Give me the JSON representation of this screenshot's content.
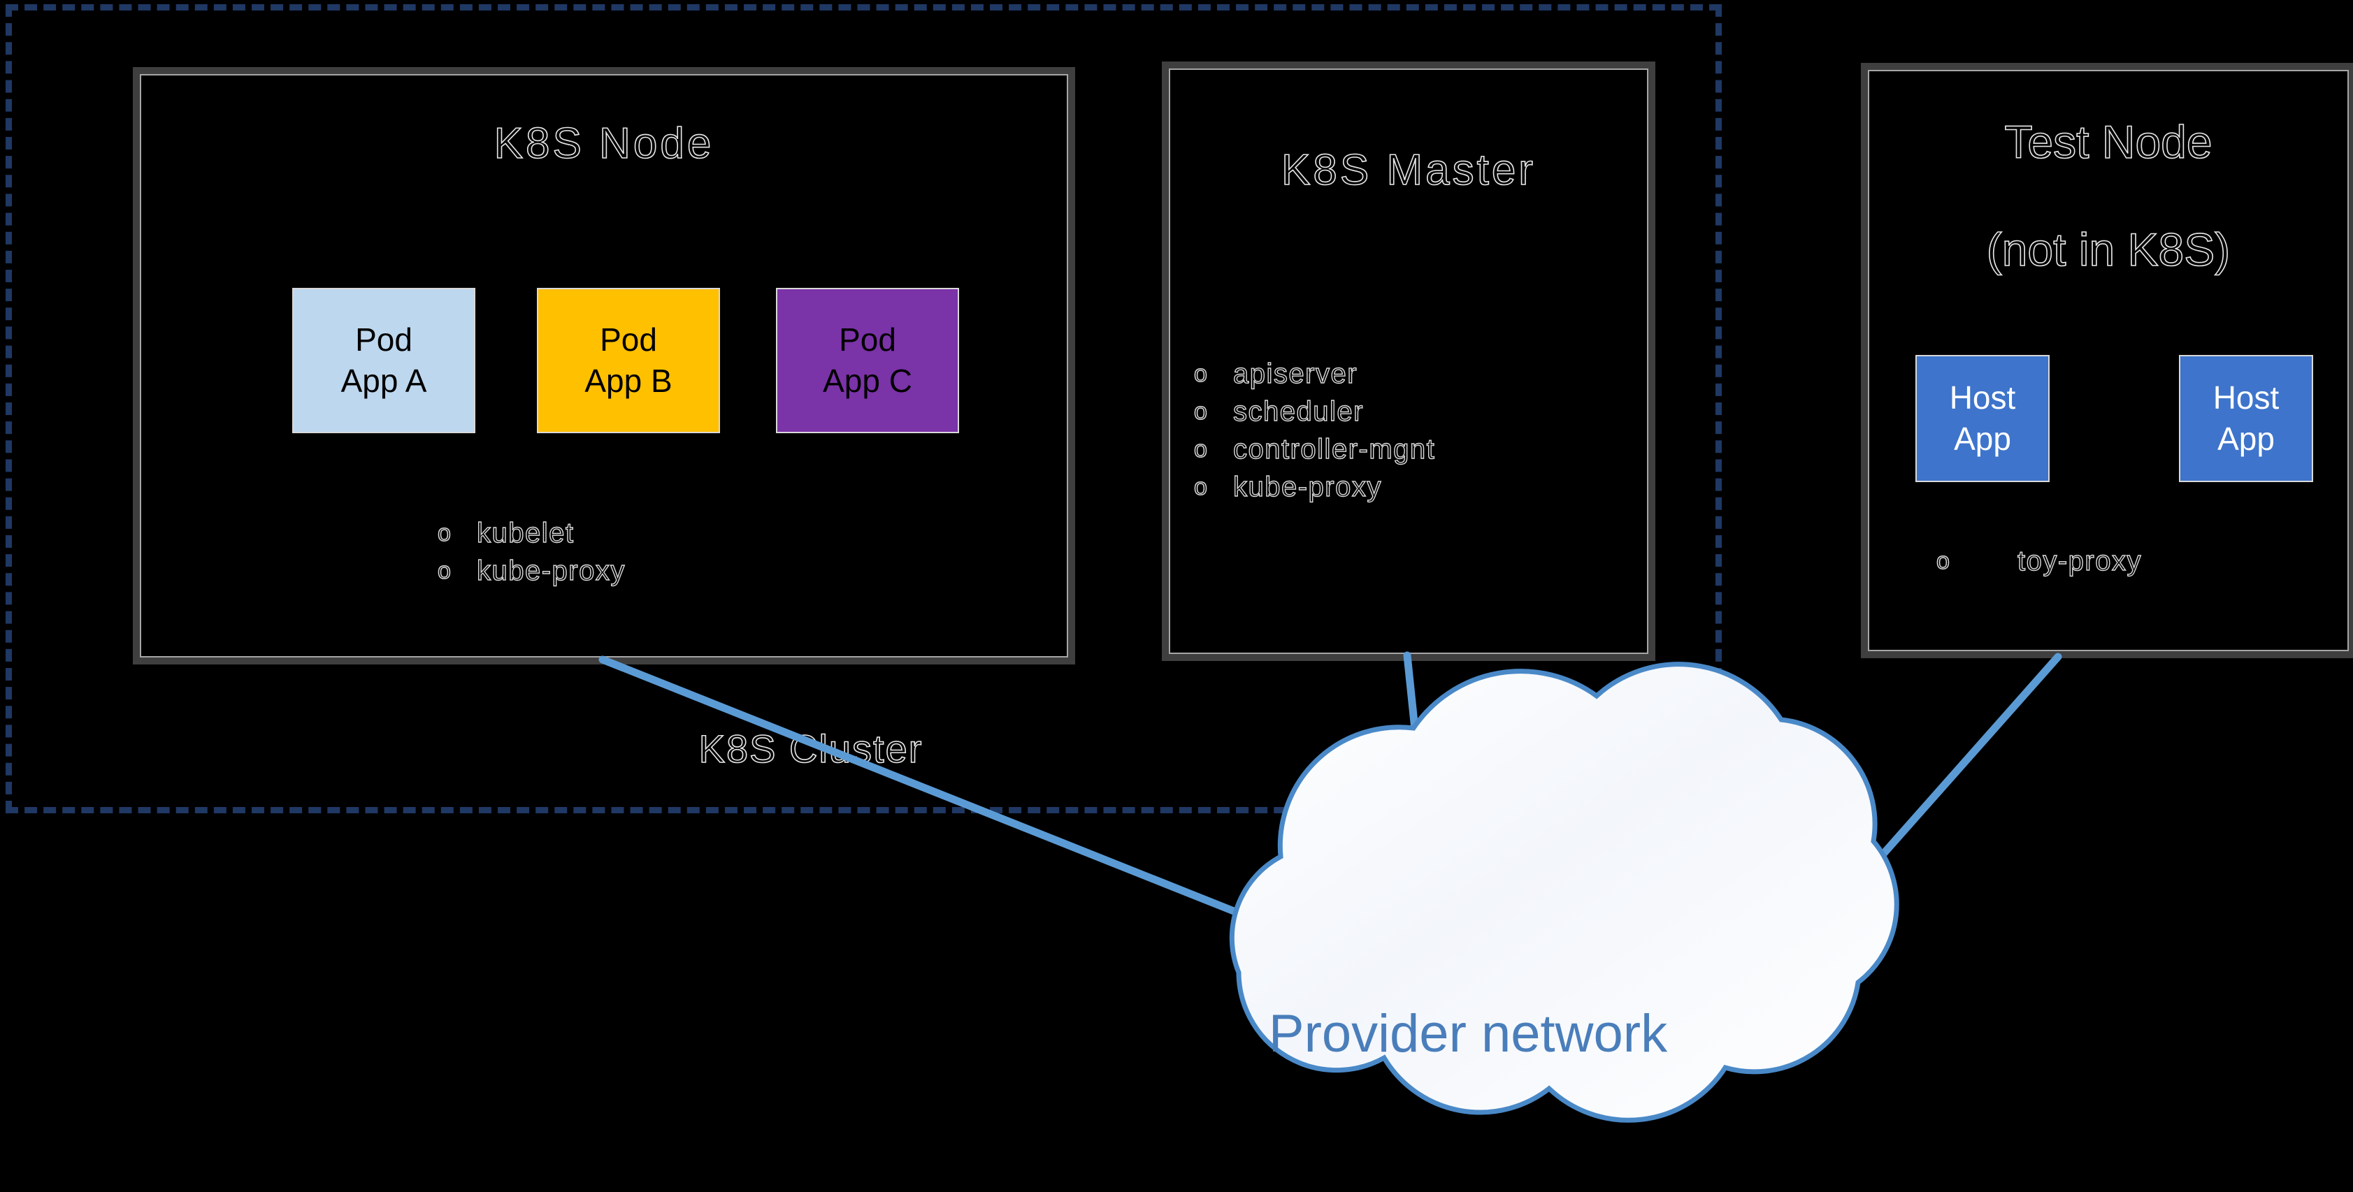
{
  "diagram": {
    "background_color": "#000000",
    "cluster": {
      "label": "K8S Cluster",
      "border_color": "#1F3864",
      "border_style": "dashed"
    },
    "nodes": [
      {
        "id": "k8s-node",
        "title": "K8S Node",
        "title_2": "",
        "border_color": "#3F3F3F",
        "tiles": [
          {
            "line1": "Pod",
            "line2": "App A",
            "fill": "#BDD7EE",
            "text_color": "#000000"
          },
          {
            "line1": "Pod",
            "line2": "App B",
            "fill": "#FFC000",
            "text_color": "#000000"
          },
          {
            "line1": "Pod",
            "line2": "App C",
            "fill": "#7B33A8",
            "text_color": "#000000"
          }
        ],
        "services": [
          "kubelet",
          "kube-proxy"
        ],
        "bullet_glyph": "o"
      },
      {
        "id": "k8s-master",
        "title": "K8S Master",
        "title_2": "",
        "border_color": "#3F3F3F",
        "tiles": [],
        "services": [
          "apiserver",
          "scheduler",
          "controller-mgnt",
          "kube-proxy"
        ],
        "bullet_glyph": "o"
      },
      {
        "id": "test-node",
        "title": "Test Node",
        "title_2": "(not in K8S)",
        "border_color": "#3F3F3F",
        "tiles": [
          {
            "line1": "Host",
            "line2": "App",
            "fill": "#3E74CB",
            "text_color": "#FFFFFF"
          },
          {
            "line1": "Host",
            "line2": "App",
            "fill": "#3E74CB",
            "text_color": "#FFFFFF"
          }
        ],
        "services": [
          "toy-proxy"
        ],
        "bullet_glyph": "o"
      }
    ],
    "cloud": {
      "label": "Provider network",
      "text_color": "#4A7EBB",
      "outline_color": "#4A89C8",
      "fill_color": "#FBFCFE"
    },
    "connectors": {
      "color": "#5B9BD5",
      "links": [
        {
          "from": "k8s-node",
          "to": "cloud"
        },
        {
          "from": "k8s-master",
          "to": "cloud"
        },
        {
          "from": "test-node",
          "to": "cloud"
        }
      ]
    }
  }
}
